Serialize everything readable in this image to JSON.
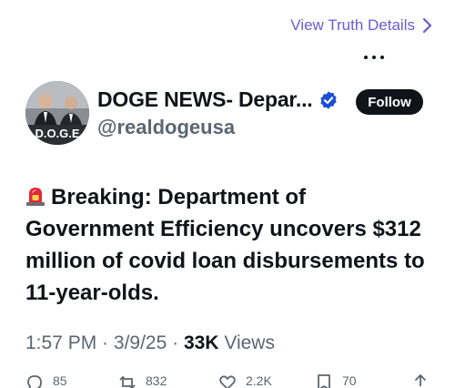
{
  "top_link": {
    "label": "View Truth Details"
  },
  "author": {
    "display_name": "DOGE NEWS- Depar...",
    "handle": "@realdogeusa",
    "avatar_text": "D.O.G.E"
  },
  "follow_button": {
    "label": "Follow"
  },
  "post": {
    "text": "Breaking: Department of Government Efficiency uncovers $312 million of covid loan disbursements to 11-year-olds."
  },
  "meta": {
    "time": "1:57 PM",
    "sep1": " · ",
    "date": "3/9/25",
    "sep2": " · ",
    "views_count": "33K",
    "views_label": " Views"
  },
  "actions": {
    "replies": "85",
    "reposts": "832",
    "likes": "2.2K",
    "bookmarks": "70"
  },
  "colors": {
    "link": "#6a5bd6",
    "verified": "#1d4ed8",
    "text": "#0f1419",
    "muted": "#5b6670"
  }
}
